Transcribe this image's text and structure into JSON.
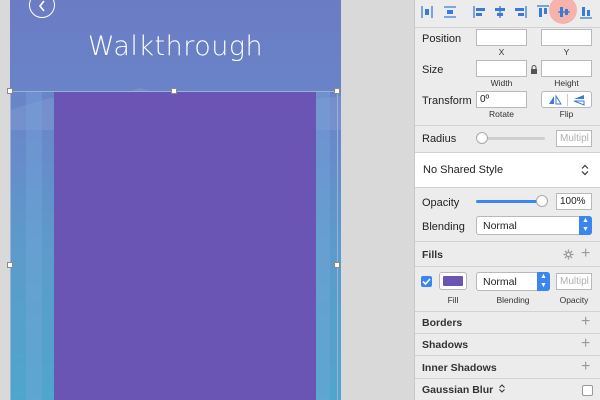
{
  "artboard": {
    "title": "Walkthrough"
  },
  "inspector": {
    "position": {
      "label": "Position",
      "x_label": "X",
      "y_label": "Y",
      "x_value": "",
      "y_value": ""
    },
    "size": {
      "label": "Size",
      "width_label": "Width",
      "height_label": "Height",
      "width_value": "",
      "height_value": ""
    },
    "transform": {
      "label": "Transform",
      "rotate_value": "0º",
      "rotate_label": "Rotate",
      "flip_label": "Flip"
    },
    "radius": {
      "label": "Radius",
      "placeholder": "Multipl"
    },
    "shared_style": {
      "value": "No Shared Style"
    },
    "opacity": {
      "label": "Opacity",
      "value": "100%",
      "level": 1.0
    },
    "blending": {
      "label": "Blending",
      "value": "Normal"
    },
    "fills": {
      "section_label": "Fills",
      "enabled": true,
      "color": "#6b55b4",
      "blend_value": "Normal",
      "opacity_placeholder": "Multipl",
      "fill_label": "Fill",
      "blending_label": "Blending",
      "opacity_label": "Opacity"
    },
    "sections": {
      "borders": "Borders",
      "shadows": "Shadows",
      "inner_shadows": "Inner Shadows",
      "gaussian_blur": "Gaussian Blur"
    }
  },
  "colors": {
    "accent": "#3a86f0",
    "fill": "#6b55b4",
    "highlight": "#f6b3ab"
  }
}
